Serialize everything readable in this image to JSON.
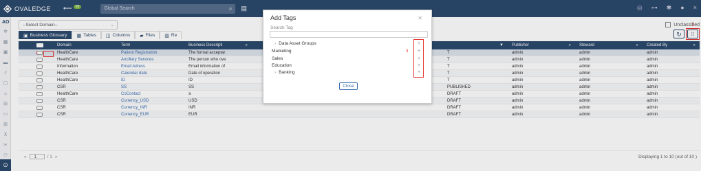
{
  "app": {
    "brand": "OVALEDGE",
    "badge": "99",
    "search_placeholder": "Global Search"
  },
  "domain_select": {
    "value": "--Select Domain--"
  },
  "tabs": [
    {
      "label": "Business Glossary",
      "icon": "book-icon"
    },
    {
      "label": "Tables",
      "icon": "table-icon"
    },
    {
      "label": "Columns",
      "icon": "columns-icon"
    },
    {
      "label": "Files",
      "icon": "folder-icon"
    },
    {
      "label": "Re",
      "icon": "report-icon"
    }
  ],
  "unclassified_label": "Unclassified",
  "annotations": {
    "n1": "1",
    "n2": "2",
    "n3": "3"
  },
  "grid": {
    "headers": {
      "domain": "Domain",
      "term": "Term",
      "desc": "Business Descripti",
      "status": "",
      "pub": "Publisher",
      "stew": "Steward",
      "cre": "Created By"
    },
    "rows": [
      {
        "domain": "HealthCare",
        "term": "Patient Registration",
        "desc": "The formal acceptar",
        "status": "T",
        "pub": "admin",
        "stew": "admin",
        "cre": "admin"
      },
      {
        "domain": "HealthCare",
        "term": "Ancillary Services",
        "desc": "The person who ove",
        "status": "T",
        "pub": "admin",
        "stew": "admin",
        "cre": "admin"
      },
      {
        "domain": "Information",
        "term": "Email Adress",
        "desc": "Email information of",
        "status": "T",
        "pub": "admin",
        "stew": "admin",
        "cre": "admin"
      },
      {
        "domain": "HealthCare",
        "term": "Calendar date",
        "desc": "Date of operation",
        "status": "T",
        "pub": "admin",
        "stew": "admin",
        "cre": "admin"
      },
      {
        "domain": "HealthCare",
        "term": "ID",
        "desc": "ID",
        "status": "T",
        "pub": "admin",
        "stew": "admin",
        "cre": "admin"
      },
      {
        "domain": "CSR",
        "term": "SS",
        "desc": "SS",
        "status": "PUBLISHED",
        "pub": "admin",
        "stew": "admin",
        "cre": "admin"
      },
      {
        "domain": "HealthCare",
        "term": "CoContact",
        "desc": "a",
        "status": "DRAFT",
        "pub": "admin",
        "stew": "admin",
        "cre": "admin"
      },
      {
        "domain": "CSR",
        "term": "Currency_USD",
        "desc": "USD",
        "status": "DRAFT",
        "pub": "admin",
        "stew": "admin",
        "cre": "admin"
      },
      {
        "domain": "CSR",
        "term": "Currency_INR",
        "desc": "INR",
        "status": "DRAFT",
        "pub": "admin",
        "stew": "admin",
        "cre": "admin"
      },
      {
        "domain": "CSR",
        "term": "Currency_EUR",
        "desc": "EUR",
        "status": "DRAFT",
        "pub": "admin",
        "stew": "admin",
        "cre": "admin"
      }
    ]
  },
  "pager": {
    "page": "1",
    "of": "/ 1",
    "display": "Displaying 1 to 10 (out of 10 )"
  },
  "modal": {
    "title": "Add Tags",
    "search_label": "Search Tag",
    "tags": [
      {
        "label": "Data Asset Groups",
        "child": true
      },
      {
        "label": "Marketing",
        "child": false
      },
      {
        "label": "Sales",
        "child": false
      },
      {
        "label": "Education",
        "child": false
      },
      {
        "label": "Banking",
        "child": true
      }
    ],
    "close_label": "Close"
  }
}
